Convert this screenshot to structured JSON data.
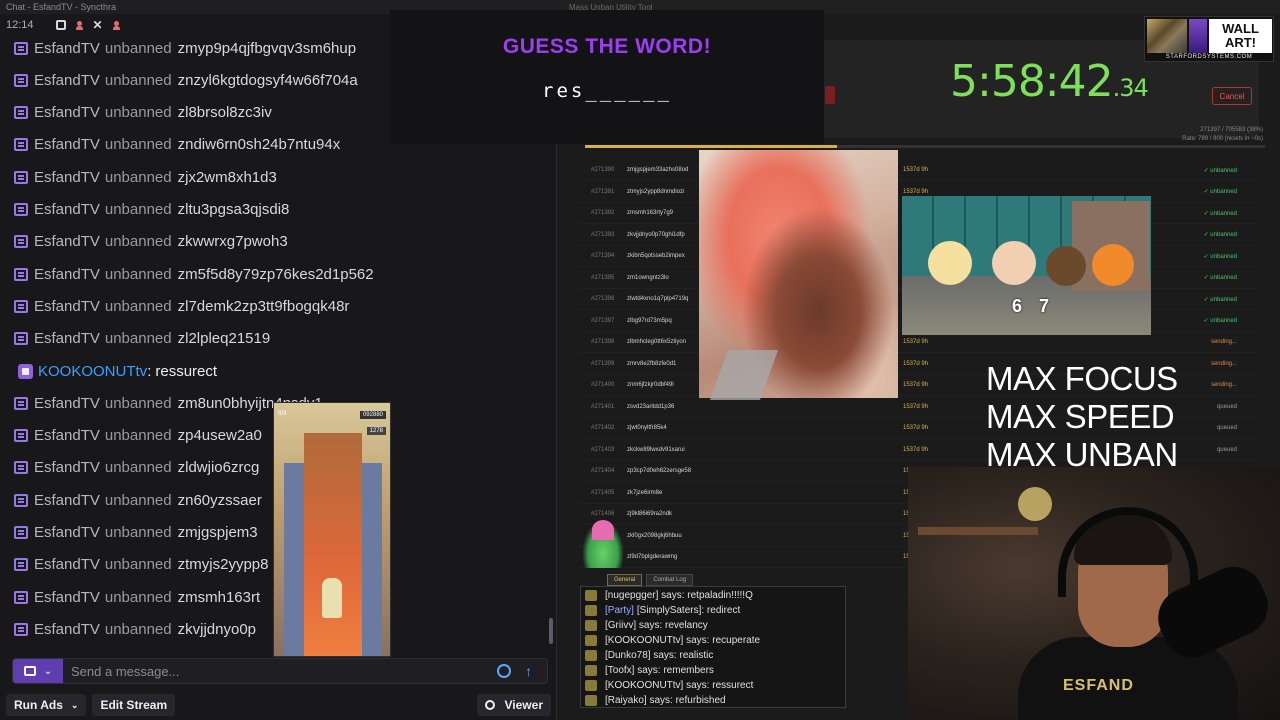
{
  "chat": {
    "window_title": "Chat - EsfandTV - Syncthra",
    "clock": "12:14",
    "messages": [
      {
        "user": "EsfandTV",
        "action": "unbanned",
        "target": "zmyp9p4qjfbgvqv3sm6hup"
      },
      {
        "user": "EsfandTV",
        "action": "unbanned",
        "target": "znzyl6kgtdogsyf4w66f704a"
      },
      {
        "user": "EsfandTV",
        "action": "unbanned",
        "target": "zl8brsol8zc3iv"
      },
      {
        "user": "EsfandTV",
        "action": "unbanned",
        "target": "zndiw6rn0sh24b7ntu94x"
      },
      {
        "user": "EsfandTV",
        "action": "unbanned",
        "target": "zjx2wm8xh1d3"
      },
      {
        "user": "EsfandTV",
        "action": "unbanned",
        "target": "zltu3pgsa3qjsdi8"
      },
      {
        "user": "EsfandTV",
        "action": "unbanned",
        "target": "zkwwrxg7pwoh3"
      },
      {
        "user": "EsfandTV",
        "action": "unbanned",
        "target": "zm5f5d8y79zp76kes2d1p562"
      },
      {
        "user": "EsfandTV",
        "action": "unbanned",
        "target": "zl7demk2zp3tt9fbogqk48r"
      },
      {
        "user": "EsfandTV",
        "action": "unbanned",
        "target": "zl2lpleq21519"
      },
      {
        "user": "KOOKOONUTtv",
        "action": "",
        "target": "ressurect",
        "is_chat": true
      },
      {
        "user": "EsfandTV",
        "action": "unbanned",
        "target": "zm8un0bhyijtn4nsdv1"
      },
      {
        "user": "EsfandTV",
        "action": "unbanned",
        "target": "zp4usew2a0"
      },
      {
        "user": "EsfandTV",
        "action": "unbanned",
        "target": "zldwjio6zrcg"
      },
      {
        "user": "EsfandTV",
        "action": "unbanned",
        "target": "zn60yzssaer"
      },
      {
        "user": "EsfandTV",
        "action": "unbanned",
        "target": "zmjgspjem3"
      },
      {
        "user": "EsfandTV",
        "action": "unbanned",
        "target": "ztmyjs2yypp8"
      },
      {
        "user": "EsfandTV",
        "action": "unbanned",
        "target": "zmsmh163rt"
      },
      {
        "user": "EsfandTV",
        "action": "unbanned",
        "target": "zkvjjdnyo0p"
      }
    ],
    "composer_placeholder": "Send a message...",
    "run_ads_label": "Run Ads",
    "edit_stream_label": "Edit Stream",
    "viewer_label": "Viewer"
  },
  "guess": {
    "title": "GUESS THE WORD!",
    "word": "res______"
  },
  "app": {
    "window_title": "Mass Unban Utility Tool",
    "cancel_label": "Cancel",
    "progress_line1": "271397 / 705583 (38%)",
    "progress_line2": "Rate: 789 / 800 (resets in ~0s)",
    "progress_percent": 38,
    "rows": [
      {
        "num": "#271390",
        "name": "zmjgspjem33azhs08od",
        "age": "1537d 9h",
        "status": "✓ unbanned",
        "kind": "unbanned"
      },
      {
        "num": "#271391",
        "name": "ztmyjs2ypp8dnmdiozi",
        "age": "1537d 9h",
        "status": "✓ unbanned",
        "kind": "unbanned"
      },
      {
        "num": "#271392",
        "name": "zmsmh163rty7g9",
        "age": "1537d 9h",
        "status": "✓ unbanned",
        "kind": "unbanned"
      },
      {
        "num": "#271393",
        "name": "zkvjjdnyo0p70ghi1dfp",
        "age": "1537d 9h",
        "status": "✓ unbanned",
        "kind": "unbanned"
      },
      {
        "num": "#271394",
        "name": "zkibn5qotsseb2impex",
        "age": "1537d 9h",
        "status": "✓ unbanned",
        "kind": "unbanned"
      },
      {
        "num": "#271395",
        "name": "zm1owngntz3lo",
        "age": "1537d 9h",
        "status": "✓ unbanned",
        "kind": "unbanned"
      },
      {
        "num": "#271396",
        "name": "zlwtd4xno1q7plp4719q",
        "age": "1537d 9h",
        "status": "✓ unbanned",
        "kind": "unbanned"
      },
      {
        "num": "#271397",
        "name": "zlbg97rd73m5pq",
        "age": "1537d 9h",
        "status": "✓ unbanned",
        "kind": "unbanned"
      },
      {
        "num": "#271398",
        "name": "zlbmhcleg0tt6x5ztiyon",
        "age": "1537d 9h",
        "status": "sending...",
        "kind": "sending"
      },
      {
        "num": "#271399",
        "name": "zmrv8e2fb8zfe0d1",
        "age": "1537d 9h",
        "status": "sending...",
        "kind": "sending"
      },
      {
        "num": "#271400",
        "name": "znm6jfzkjr0dbf49l",
        "age": "1537d 9h",
        "status": "sending...",
        "kind": "sending"
      },
      {
        "num": "#271401",
        "name": "zsvd23aritdd1p36",
        "age": "1537d 9h",
        "status": "queued",
        "kind": "queued"
      },
      {
        "num": "#271402",
        "name": "zjwt0nyltfr85k4",
        "age": "1537d 9h",
        "status": "queued",
        "kind": "queued"
      },
      {
        "num": "#271403",
        "name": "zkckw89lwxdv91xarui",
        "age": "1537d 9h",
        "status": "queued",
        "kind": "queued"
      },
      {
        "num": "#271404",
        "name": "zp3cp7d0eh62zersge58",
        "age": "1537d 9h",
        "status": "queued",
        "kind": "queued"
      },
      {
        "num": "#271405",
        "name": "zk7jze6irm8e",
        "age": "1537d 9h",
        "status": "queued",
        "kind": "queued"
      },
      {
        "num": "#271406",
        "name": "zj9kl86i69ra2ndk",
        "age": "1537d 9h",
        "status": "queued",
        "kind": "queued"
      },
      {
        "num": "#271407",
        "name": "zkl0gx2098gkj6hbuu",
        "age": "1537d 9h",
        "status": "queued",
        "kind": "queued"
      },
      {
        "num": "#271408",
        "name": "zl9d7bplgderawmg",
        "age": "1537d 9h",
        "status": "queued",
        "kind": "queued"
      }
    ],
    "tab_general": "General",
    "tab_log": "Combat Log"
  },
  "timer": {
    "main": "5:58:42",
    "fraction": ".34"
  },
  "sponsor": {
    "brand": "WALL ART!",
    "url": "STARFORDSYSTEMS.COM"
  },
  "cartoon_number": "6 7",
  "max_lines": [
    "MAX FOCUS",
    "MAX SPEED",
    "MAX UNBAN"
  ],
  "game": {
    "hud_left": "0/3",
    "hud_score": "092880",
    "hud_coins": "1278"
  },
  "webcam": {
    "shirt_text": "ESFAND"
  },
  "ingame_chat": [
    {
      "party": "",
      "text": "[nugepgger] says: retpaladin!!!!!Q"
    },
    {
      "party": "[Party]",
      "text": "[SimplySaters]: redirect"
    },
    {
      "party": "",
      "text": "[Griivv] says: revelancy"
    },
    {
      "party": "",
      "text": "[KOOKOONUTtv] says: recuperate"
    },
    {
      "party": "",
      "text": "[Dunko78] says: realistic"
    },
    {
      "party": "",
      "text": "[Toofx] says: remembers"
    },
    {
      "party": "",
      "text": "[KOOKOONUTtv] says: ressurect"
    },
    {
      "party": "",
      "text": "[Raiyako] says: refurbished"
    }
  ],
  "colors": {
    "accent": "#9147ff",
    "guess_title": "#9f3df5",
    "timer": "#7ee05a",
    "unbanned": "#4ac26b",
    "sending": "#e08a3a"
  }
}
